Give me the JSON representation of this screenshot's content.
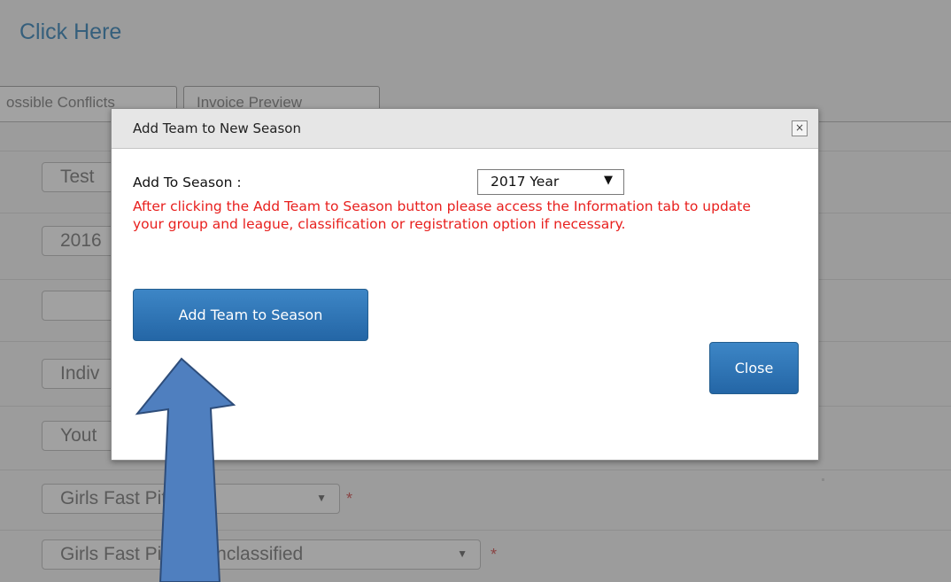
{
  "page": {
    "click_here": "Click Here",
    "tabs": [
      "ossible Conflicts",
      "Invoice Preview"
    ],
    "fields": [
      {
        "value": "Test"
      },
      {
        "value": "2016"
      },
      {
        "value": ""
      },
      {
        "value": "Indiv"
      },
      {
        "value": "Yout"
      },
      {
        "value": "Girls Fast Pitch",
        "has_arrow": true
      },
      {
        "value": "Girls Fast Pitch - Unclassified",
        "has_arrow": true
      }
    ],
    "required_marker": "*"
  },
  "modal": {
    "title": "Add Team to New Season",
    "close_glyph": "×",
    "season_label": "Add To Season :",
    "season_selected": "2017 Year",
    "select_arrow": "▼",
    "warning": "After clicking the Add Team to Season button please access the Information tab to update your group and league, classification or registration option if necessary.",
    "add_button": "Add Team to Season",
    "close_button": "Close"
  },
  "colors": {
    "overlay": "#9c9c9c",
    "warning": "#e8201e",
    "button": "#2f74b5",
    "arrow_fill": "#4f7fbf",
    "arrow_stroke": "#2e4d7a"
  }
}
